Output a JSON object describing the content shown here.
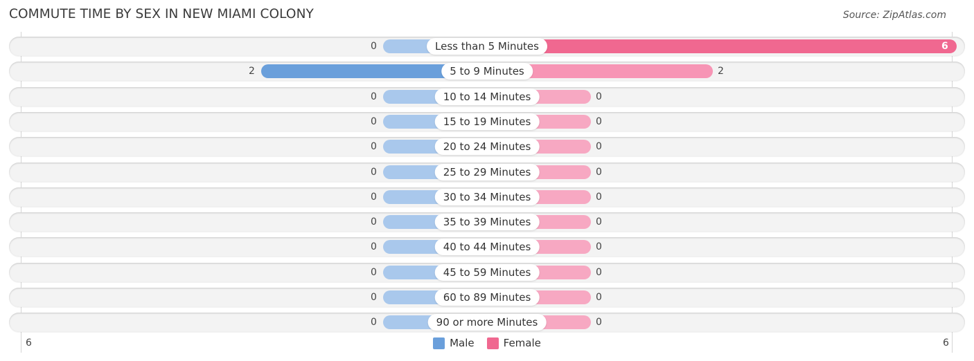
{
  "header": {
    "title": "COMMUTE TIME BY SEX IN NEW MIAMI COLONY",
    "source": "Source: ZipAtlas.com"
  },
  "colors": {
    "male_strong": "#6a9fdb",
    "male_light": "#a9c8ec",
    "female_strong": "#f06890",
    "female_light": "#f7a8c2"
  },
  "chart_data": {
    "type": "bar",
    "orientation": "horizontal-diverging",
    "title": "COMMUTE TIME BY SEX IN NEW MIAMI COLONY",
    "categories": [
      "Less than 5 Minutes",
      "5 to 9 Minutes",
      "10 to 14 Minutes",
      "15 to 19 Minutes",
      "20 to 24 Minutes",
      "25 to 29 Minutes",
      "30 to 34 Minutes",
      "35 to 39 Minutes",
      "40 to 44 Minutes",
      "45 to 59 Minutes",
      "60 to 89 Minutes",
      "90 or more Minutes"
    ],
    "series": [
      {
        "name": "Male",
        "values": [
          0,
          2,
          0,
          0,
          0,
          0,
          0,
          0,
          0,
          0,
          0,
          0
        ]
      },
      {
        "name": "Female",
        "values": [
          6,
          2,
          0,
          0,
          0,
          0,
          0,
          0,
          0,
          0,
          0,
          0
        ]
      }
    ],
    "axis": {
      "left_tick": "6",
      "right_tick": "6",
      "max": 6
    },
    "legend": {
      "position": "bottom-center",
      "entries": [
        "Male",
        "Female"
      ]
    }
  }
}
